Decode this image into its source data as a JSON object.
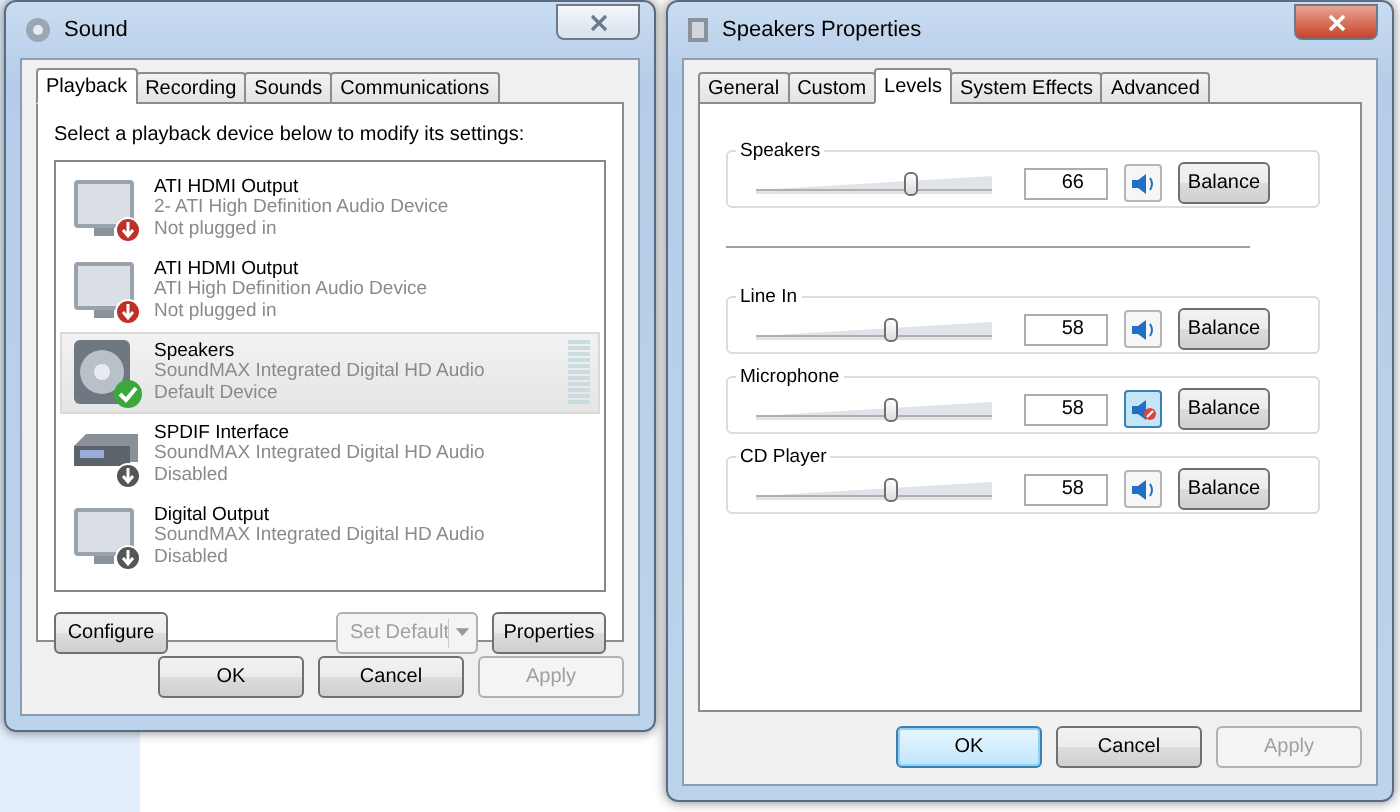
{
  "sound_window": {
    "title": "Sound",
    "tabs": [
      {
        "label": "Playback",
        "selected": true
      },
      {
        "label": "Recording",
        "selected": false
      },
      {
        "label": "Sounds",
        "selected": false
      },
      {
        "label": "Communications",
        "selected": false
      }
    ],
    "instruction": "Select a playback device below to modify its settings:",
    "devices": [
      {
        "kind": "monitor",
        "is_default": false,
        "plugged_in": false,
        "name": "ATI HDMI Output",
        "description": "2- ATI High Definition Audio Device",
        "state": "Not plugged in",
        "selected": false
      },
      {
        "kind": "monitor",
        "is_default": false,
        "plugged_in": false,
        "name": "ATI HDMI Output",
        "description": "ATI High Definition Audio Device",
        "state": "Not plugged in",
        "selected": false
      },
      {
        "kind": "speaker",
        "is_default": true,
        "plugged_in": true,
        "name": "Speakers",
        "description": "SoundMAX Integrated Digital HD Audio",
        "state": "Default Device",
        "selected": true
      },
      {
        "kind": "spdif",
        "is_default": false,
        "plugged_in": true,
        "name": "SPDIF Interface",
        "description": "SoundMAX Integrated Digital HD Audio",
        "state": "Disabled",
        "selected": false
      },
      {
        "kind": "monitor",
        "is_default": false,
        "plugged_in": true,
        "name": "Digital Output",
        "description": "SoundMAX Integrated Digital HD Audio",
        "state": "Disabled",
        "selected": false
      }
    ],
    "configure_button": "Configure",
    "set_default_button": {
      "label": "Set Default",
      "disabled": true
    },
    "properties_button": "Properties",
    "buttons": [
      {
        "label": "OK",
        "disabled": false
      },
      {
        "label": "Cancel",
        "disabled": false
      },
      {
        "label": "Apply",
        "disabled": true
      }
    ]
  },
  "properties_window": {
    "title": "Speakers Properties",
    "tabs": [
      {
        "label": "General",
        "selected": false
      },
      {
        "label": "Custom",
        "selected": false
      },
      {
        "label": "Levels",
        "selected": true
      },
      {
        "label": "System Effects",
        "selected": false
      },
      {
        "label": "Advanced",
        "selected": false
      }
    ],
    "main_channel": {
      "name": "Speakers",
      "level": 0.66,
      "value": "66",
      "muted": false,
      "balance_button": "Balance"
    },
    "channels": [
      {
        "name": "Line In",
        "level": 0.58,
        "value": "58",
        "muted": false,
        "balance_button": "Balance"
      },
      {
        "name": "Microphone",
        "level": 0.58,
        "value": "58",
        "muted": true,
        "balance_button": "Balance"
      },
      {
        "name": "CD Player",
        "level": 0.58,
        "value": "58",
        "muted": false,
        "balance_button": "Balance"
      }
    ],
    "buttons": [
      {
        "label": "OK",
        "disabled": false
      },
      {
        "label": "Cancel",
        "disabled": false
      },
      {
        "label": "Apply",
        "disabled": true
      }
    ]
  }
}
